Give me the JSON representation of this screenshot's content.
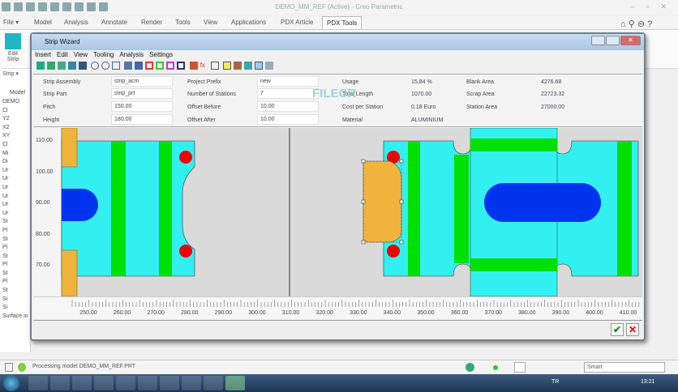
{
  "window": {
    "title": "DEMO_MM_REF (Active) - Creo Parametric",
    "controls": "–  ▫  ✕"
  },
  "ribbon": {
    "file": "File ▾",
    "tabs": [
      "Model",
      "Analysis",
      "Annotate",
      "Render",
      "Tools",
      "View",
      "Applications",
      "PDX Article",
      "PDX Tools"
    ],
    "active_tab": "PDX Tools",
    "edit_strip": "Edit Strip",
    "strip_group": "Strip ▾"
  },
  "left_panel": {
    "model_tab": "Model",
    "tree": [
      "DEMO",
      "Cl",
      "Y2",
      "X2",
      "XY",
      "Cl",
      "Mi",
      "Di",
      "Ur",
      "Ur",
      "Ur",
      "Ur",
      "Ur",
      "Ur",
      "St",
      "Pl",
      "St",
      "Pl",
      "St",
      "Pl",
      "St",
      "Pl",
      "St",
      "Si",
      "Si",
      "Surface in Latin"
    ]
  },
  "dialog": {
    "title": "Strip Wizard",
    "menu": [
      "Insert",
      "Edit",
      "View",
      "Tooling",
      "Analysis",
      "Settings"
    ],
    "fields": {
      "strip_assembly": {
        "label": "Strip Assembly",
        "value": "strip_acm"
      },
      "strip_part": {
        "label": "Strip Part",
        "value": "strip_prt"
      },
      "pitch": {
        "label": "Pitch",
        "value": "150.00"
      },
      "height": {
        "label": "Height",
        "value": "180.00"
      },
      "project_prefix": {
        "label": "Project Prefix",
        "value": "new"
      },
      "number_of_stations": {
        "label": "Number of Stations",
        "value": "7"
      },
      "offset_before": {
        "label": "Offset Before",
        "value": "10.00"
      },
      "offset_after": {
        "label": "Offset After",
        "value": "10.00"
      }
    },
    "stats": {
      "usage": {
        "label": "Usage",
        "value": "15.84 %"
      },
      "total_length": {
        "label": "Total Length",
        "value": "1070.00"
      },
      "cost_per_station": {
        "label": "Cost per Station",
        "value": "0.18 Euro"
      },
      "material": {
        "label": "Material",
        "value": "ALUMINIUM"
      },
      "blank_area": {
        "label": "Blank Area",
        "value": "4276.68"
      },
      "scrap_area": {
        "label": "Scrap Area",
        "value": "22723.32"
      },
      "station_area": {
        "label": "Station Area",
        "value": "27000.00"
      }
    },
    "vruler": [
      "110.00",
      "100.00",
      "90.00",
      "80.00",
      "70.00"
    ],
    "hruler": [
      "250.00",
      "260.00",
      "270.00",
      "280.00",
      "290.00",
      "300.00",
      "310.00",
      "320.00",
      "330.00",
      "340.00",
      "350.00",
      "360.00",
      "370.00",
      "380.00",
      "390.00",
      "400.00",
      "410.00"
    ],
    "ok": "✔",
    "cancel": "✕"
  },
  "watermark": "FILECR",
  "status": {
    "message": "Processing model DEMO_MM_REF.PRT",
    "filter": "Smart"
  },
  "taskbar": {
    "lang": "TR",
    "time": "13:21"
  },
  "colors": {
    "cyan": "#33f0f0",
    "green": "#00e000",
    "blue": "#0033ee",
    "orange": "#f0b43c",
    "red": "#ee0000"
  }
}
